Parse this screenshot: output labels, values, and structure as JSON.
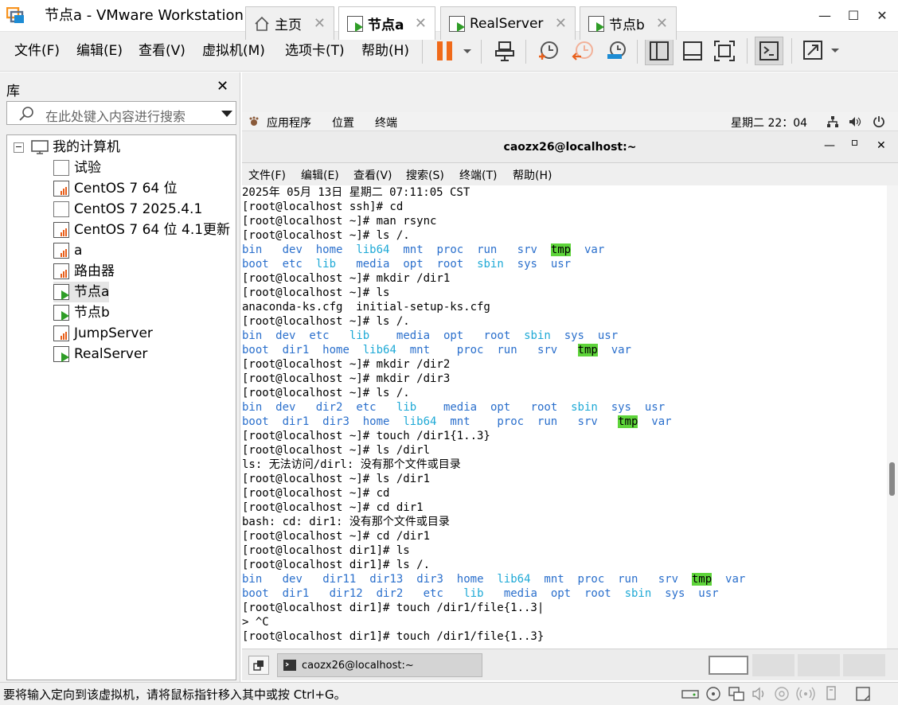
{
  "window": {
    "title": "节点a - VMware Workstation",
    "minimize": "—",
    "maximize": "☐",
    "close": "✕"
  },
  "menubar": {
    "items": [
      "文件(F)",
      "编辑(E)",
      "查看(V)",
      "虚拟机(M)",
      "选项卡(T)",
      "帮助(H)"
    ]
  },
  "library": {
    "title": "库",
    "close": "✕",
    "search_placeholder": "在此处键入内容进行搜索",
    "root": "我的计算机",
    "items": [
      {
        "label": "试验",
        "icon": "vm-off"
      },
      {
        "label": "CentOS 7 64 位",
        "icon": "vm-suspended"
      },
      {
        "label": "CentOS 7 2025.4.1",
        "icon": "vm-off"
      },
      {
        "label": "CentOS 7 64 位 4.1更新",
        "icon": "vm-suspended"
      },
      {
        "label": "a",
        "icon": "vm-suspended"
      },
      {
        "label": "路由器",
        "icon": "vm-suspended"
      },
      {
        "label": "节点a",
        "icon": "vm-running",
        "selected": true
      },
      {
        "label": "节点b",
        "icon": "vm-running"
      },
      {
        "label": "JumpServer",
        "icon": "vm-suspended"
      },
      {
        "label": "RealServer",
        "icon": "vm-running"
      }
    ]
  },
  "tabs": [
    {
      "label": "主页",
      "icon": "home-icon",
      "active": false
    },
    {
      "label": "节点a",
      "icon": "vm-running",
      "active": true
    },
    {
      "label": "RealServer",
      "icon": "vm-running",
      "active": false
    },
    {
      "label": "节点b",
      "icon": "vm-running",
      "active": false
    }
  ],
  "gnome": {
    "apps": "应用程序",
    "places": "位置",
    "terminal": "终端",
    "clock": "星期二 22：04"
  },
  "terminal_window": {
    "title": "caozx26@localhost:~",
    "menu": [
      "文件(F)",
      "编辑(E)",
      "查看(V)",
      "搜索(S)",
      "终端(T)",
      "帮助(H)"
    ]
  },
  "terminal_lines": [
    [
      [
        "2025年 05月 13日 星期二 07:11:05 CST",
        ""
      ]
    ],
    [
      [
        "[root@localhost ssh]# cd",
        ""
      ]
    ],
    [
      [
        "[root@localhost ~]# man rsync",
        ""
      ]
    ],
    [
      [
        "[root@localhost ~]# ls /.",
        ""
      ]
    ],
    [
      [
        "bin",
        "d"
      ],
      [
        "   ",
        ""
      ],
      [
        "dev",
        "d"
      ],
      [
        "  ",
        ""
      ],
      [
        "home",
        "d"
      ],
      [
        "  ",
        ""
      ],
      [
        "lib64",
        "l"
      ],
      [
        "  ",
        ""
      ],
      [
        "mnt",
        "d"
      ],
      [
        "  ",
        ""
      ],
      [
        "proc",
        "d"
      ],
      [
        "  ",
        ""
      ],
      [
        "run",
        "d"
      ],
      [
        "   ",
        ""
      ],
      [
        "srv",
        "d"
      ],
      [
        "  ",
        ""
      ],
      [
        "tmp",
        "h"
      ],
      [
        "  ",
        ""
      ],
      [
        "var",
        "d"
      ]
    ],
    [
      [
        "boot",
        "d"
      ],
      [
        "  ",
        ""
      ],
      [
        "etc",
        "d"
      ],
      [
        "  ",
        ""
      ],
      [
        "lib",
        "l"
      ],
      [
        "   ",
        ""
      ],
      [
        "media",
        "d"
      ],
      [
        "  ",
        ""
      ],
      [
        "opt",
        "d"
      ],
      [
        "  ",
        ""
      ],
      [
        "root",
        "d"
      ],
      [
        "  ",
        ""
      ],
      [
        "sbin",
        "l"
      ],
      [
        "  ",
        ""
      ],
      [
        "sys",
        "d"
      ],
      [
        "  ",
        ""
      ],
      [
        "usr",
        "d"
      ]
    ],
    [
      [
        "[root@localhost ~]# mkdir /dir1",
        ""
      ]
    ],
    [
      [
        "[root@localhost ~]# ls",
        ""
      ]
    ],
    [
      [
        "anaconda-ks.cfg  initial-setup-ks.cfg",
        ""
      ]
    ],
    [
      [
        "[root@localhost ~]# ls /.",
        ""
      ]
    ],
    [
      [
        "bin",
        "d"
      ],
      [
        "  ",
        ""
      ],
      [
        "dev",
        "d"
      ],
      [
        "  ",
        ""
      ],
      [
        "etc",
        "d"
      ],
      [
        "   ",
        ""
      ],
      [
        "lib",
        "l"
      ],
      [
        "    ",
        ""
      ],
      [
        "media",
        "d"
      ],
      [
        "  ",
        ""
      ],
      [
        "opt",
        "d"
      ],
      [
        "   ",
        ""
      ],
      [
        "root",
        "d"
      ],
      [
        "  ",
        ""
      ],
      [
        "sbin",
        "l"
      ],
      [
        "  ",
        ""
      ],
      [
        "sys",
        "d"
      ],
      [
        "  ",
        ""
      ],
      [
        "usr",
        "d"
      ]
    ],
    [
      [
        "boot",
        "d"
      ],
      [
        "  ",
        ""
      ],
      [
        "dir1",
        "d"
      ],
      [
        "  ",
        ""
      ],
      [
        "home",
        "d"
      ],
      [
        "  ",
        ""
      ],
      [
        "lib64",
        "l"
      ],
      [
        "  ",
        ""
      ],
      [
        "mnt",
        "d"
      ],
      [
        "    ",
        ""
      ],
      [
        "proc",
        "d"
      ],
      [
        "  ",
        ""
      ],
      [
        "run",
        "d"
      ],
      [
        "   ",
        ""
      ],
      [
        "srv",
        "d"
      ],
      [
        "   ",
        ""
      ],
      [
        "tmp",
        "h"
      ],
      [
        "  ",
        ""
      ],
      [
        "var",
        "d"
      ]
    ],
    [
      [
        "[root@localhost ~]# mkdir /dir2",
        ""
      ]
    ],
    [
      [
        "[root@localhost ~]# mkdir /dir3",
        ""
      ]
    ],
    [
      [
        "[root@localhost ~]# ls /.",
        ""
      ]
    ],
    [
      [
        "bin",
        "d"
      ],
      [
        "  ",
        ""
      ],
      [
        "dev",
        "d"
      ],
      [
        "   ",
        ""
      ],
      [
        "dir2",
        "d"
      ],
      [
        "  ",
        ""
      ],
      [
        "etc",
        "d"
      ],
      [
        "   ",
        ""
      ],
      [
        "lib",
        "l"
      ],
      [
        "    ",
        ""
      ],
      [
        "media",
        "d"
      ],
      [
        "  ",
        ""
      ],
      [
        "opt",
        "d"
      ],
      [
        "   ",
        ""
      ],
      [
        "root",
        "d"
      ],
      [
        "  ",
        ""
      ],
      [
        "sbin",
        "l"
      ],
      [
        "  ",
        ""
      ],
      [
        "sys",
        "d"
      ],
      [
        "  ",
        ""
      ],
      [
        "usr",
        "d"
      ]
    ],
    [
      [
        "boot",
        "d"
      ],
      [
        "  ",
        ""
      ],
      [
        "dir1",
        "d"
      ],
      [
        "  ",
        ""
      ],
      [
        "dir3",
        "d"
      ],
      [
        "  ",
        ""
      ],
      [
        "home",
        "d"
      ],
      [
        "  ",
        ""
      ],
      [
        "lib64",
        "l"
      ],
      [
        "  ",
        ""
      ],
      [
        "mnt",
        "d"
      ],
      [
        "    ",
        ""
      ],
      [
        "proc",
        "d"
      ],
      [
        "  ",
        ""
      ],
      [
        "run",
        "d"
      ],
      [
        "   ",
        ""
      ],
      [
        "srv",
        "d"
      ],
      [
        "   ",
        ""
      ],
      [
        "tmp",
        "h"
      ],
      [
        "  ",
        ""
      ],
      [
        "var",
        "d"
      ]
    ],
    [
      [
        "[root@localhost ~]# touch /dir1{1..3}",
        ""
      ]
    ],
    [
      [
        "[root@localhost ~]# ls /dirl",
        ""
      ]
    ],
    [
      [
        "ls: 无法访问/dirl: 没有那个文件或目录",
        ""
      ]
    ],
    [
      [
        "[root@localhost ~]# ls /dir1",
        ""
      ]
    ],
    [
      [
        "[root@localhost ~]# cd",
        ""
      ]
    ],
    [
      [
        "[root@localhost ~]# cd dir1",
        ""
      ]
    ],
    [
      [
        "bash: cd: dir1: 没有那个文件或目录",
        ""
      ]
    ],
    [
      [
        "[root@localhost ~]# cd /dir1",
        ""
      ]
    ],
    [
      [
        "[root@localhost dir1]# ls",
        ""
      ]
    ],
    [
      [
        "[root@localhost dir1]# ls /.",
        ""
      ]
    ],
    [
      [
        "bin",
        "d"
      ],
      [
        "   ",
        ""
      ],
      [
        "dev",
        "d"
      ],
      [
        "   ",
        ""
      ],
      [
        "dir11",
        "d"
      ],
      [
        "  ",
        ""
      ],
      [
        "dir13",
        "d"
      ],
      [
        "  ",
        ""
      ],
      [
        "dir3",
        "d"
      ],
      [
        "  ",
        ""
      ],
      [
        "home",
        "d"
      ],
      [
        "  ",
        ""
      ],
      [
        "lib64",
        "l"
      ],
      [
        "  ",
        ""
      ],
      [
        "mnt",
        "d"
      ],
      [
        "  ",
        ""
      ],
      [
        "proc",
        "d"
      ],
      [
        "  ",
        ""
      ],
      [
        "run",
        "d"
      ],
      [
        "   ",
        ""
      ],
      [
        "srv",
        "d"
      ],
      [
        "  ",
        ""
      ],
      [
        "tmp",
        "h"
      ],
      [
        "  ",
        ""
      ],
      [
        "var",
        "d"
      ]
    ],
    [
      [
        "boot",
        "d"
      ],
      [
        "  ",
        ""
      ],
      [
        "dir1",
        "d"
      ],
      [
        "   ",
        ""
      ],
      [
        "dir12",
        "d"
      ],
      [
        "  ",
        ""
      ],
      [
        "dir2",
        "d"
      ],
      [
        "   ",
        ""
      ],
      [
        "etc",
        "d"
      ],
      [
        "   ",
        ""
      ],
      [
        "lib",
        "l"
      ],
      [
        "   ",
        ""
      ],
      [
        "media",
        "d"
      ],
      [
        "  ",
        ""
      ],
      [
        "opt",
        "d"
      ],
      [
        "  ",
        ""
      ],
      [
        "root",
        "d"
      ],
      [
        "  ",
        ""
      ],
      [
        "sbin",
        "l"
      ],
      [
        "  ",
        ""
      ],
      [
        "sys",
        "d"
      ],
      [
        "  ",
        ""
      ],
      [
        "usr",
        "d"
      ]
    ],
    [
      [
        "[root@localhost dir1]# touch /dir1/file{1..3|",
        ""
      ]
    ],
    [
      [
        "> ^C",
        ""
      ]
    ],
    [
      [
        "[root@localhost dir1]# touch /dir1/file{1..3}",
        ""
      ]
    ]
  ],
  "taskbar": {
    "item": "caozx26@localhost:~"
  },
  "statusbar": {
    "message": "要将输入定向到该虚拟机，请将鼠标指针移入其中或按 Ctrl+G。"
  },
  "colors": {
    "dir": "#2a6fcc",
    "link": "#1ea9d6",
    "highlight": "#5ed43a",
    "pause": "#f06a1a",
    "running": "#2f9d27"
  }
}
